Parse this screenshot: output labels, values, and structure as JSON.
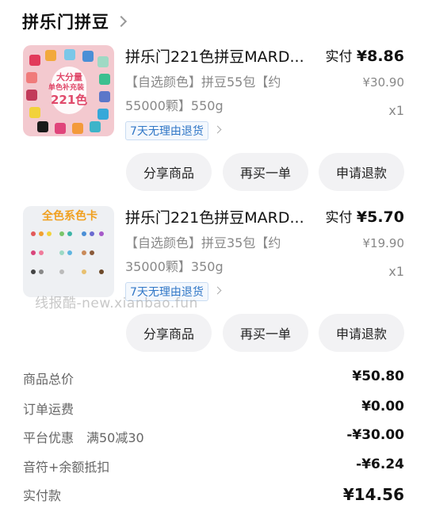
{
  "store": {
    "name": "拼乐门拼豆"
  },
  "items": [
    {
      "title": "拼乐门221色拼豆MARD...",
      "spec_line1": "【自选颜色】拼豆55包【约",
      "spec_line2": "55000颗】550g",
      "badge": "7天无理由退货",
      "paid_label": "实付",
      "paid_amount": "¥8.86",
      "original_price": "¥30.90",
      "quantity": "x1",
      "thumb_text_1": "大分量",
      "thumb_text_2": "单色补充装",
      "thumb_text_3": "221色",
      "buttons": [
        "分享商品",
        "再买一单",
        "申请退款"
      ]
    },
    {
      "title": "拼乐门221色拼豆MARD...",
      "spec_line1": "【自选颜色】拼豆35包【约",
      "spec_line2": "35000颗】350g",
      "badge": "7天无理由退货",
      "paid_label": "实付",
      "paid_amount": "¥5.70",
      "original_price": "¥19.90",
      "quantity": "x1",
      "thumb_text_1": "全色系色卡",
      "buttons": [
        "分享商品",
        "再买一单",
        "申请退款"
      ]
    }
  ],
  "watermark": "线报酷-new.xianbao.fun",
  "summary": [
    {
      "label": "商品总价",
      "value": "¥50.80"
    },
    {
      "label": "订单运费",
      "value": "¥0.00"
    },
    {
      "label": "平台优惠　满50减30",
      "value": "-¥30.00"
    },
    {
      "label": "音符+余额抵扣",
      "value": "-¥6.24"
    },
    {
      "label": "实付款",
      "value": "¥14.56"
    }
  ],
  "colors": {
    "accent_link": "#2f76c6",
    "button_bg": "#f2f2f4",
    "thumb1_bg": "#f3c9cf"
  }
}
